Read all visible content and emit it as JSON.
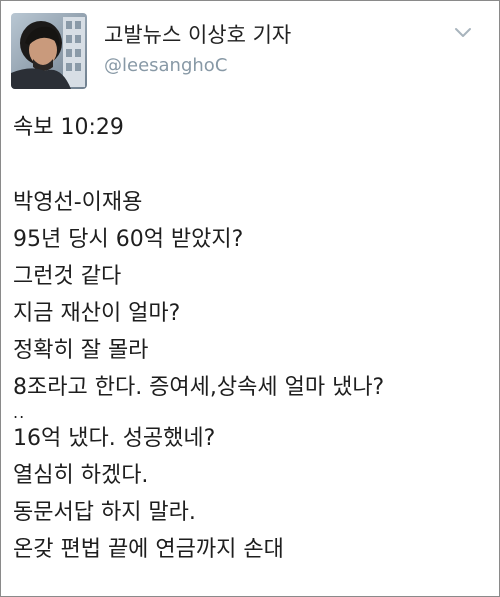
{
  "author": {
    "display_name": "고발뉴스 이상호 기자",
    "handle": "@leesanghoC",
    "avatar_icon": "profile-photo",
    "menu_icon": "chevron-down-icon"
  },
  "tweet": {
    "header_line": "속보 10:29",
    "lines": [
      "박영선-이재용",
      "95년 당시 60억 받았지?",
      "그런것 같다",
      "지금 재산이 얼마?",
      "정확히 잘 몰라",
      "8조라고 한다. 증여세,상속세 얼마 냈나?",
      "..",
      "16억 냈다. 성공했네?",
      "열심히 하겠다.",
      "동문서답 하지 말라.",
      "온갖 편법 끝에 연금까지 손대"
    ]
  },
  "colors": {
    "text": "#1e1e1e",
    "handle": "#8899a6",
    "chevron": "#a8b4bd",
    "border": "#8a8a8a"
  }
}
